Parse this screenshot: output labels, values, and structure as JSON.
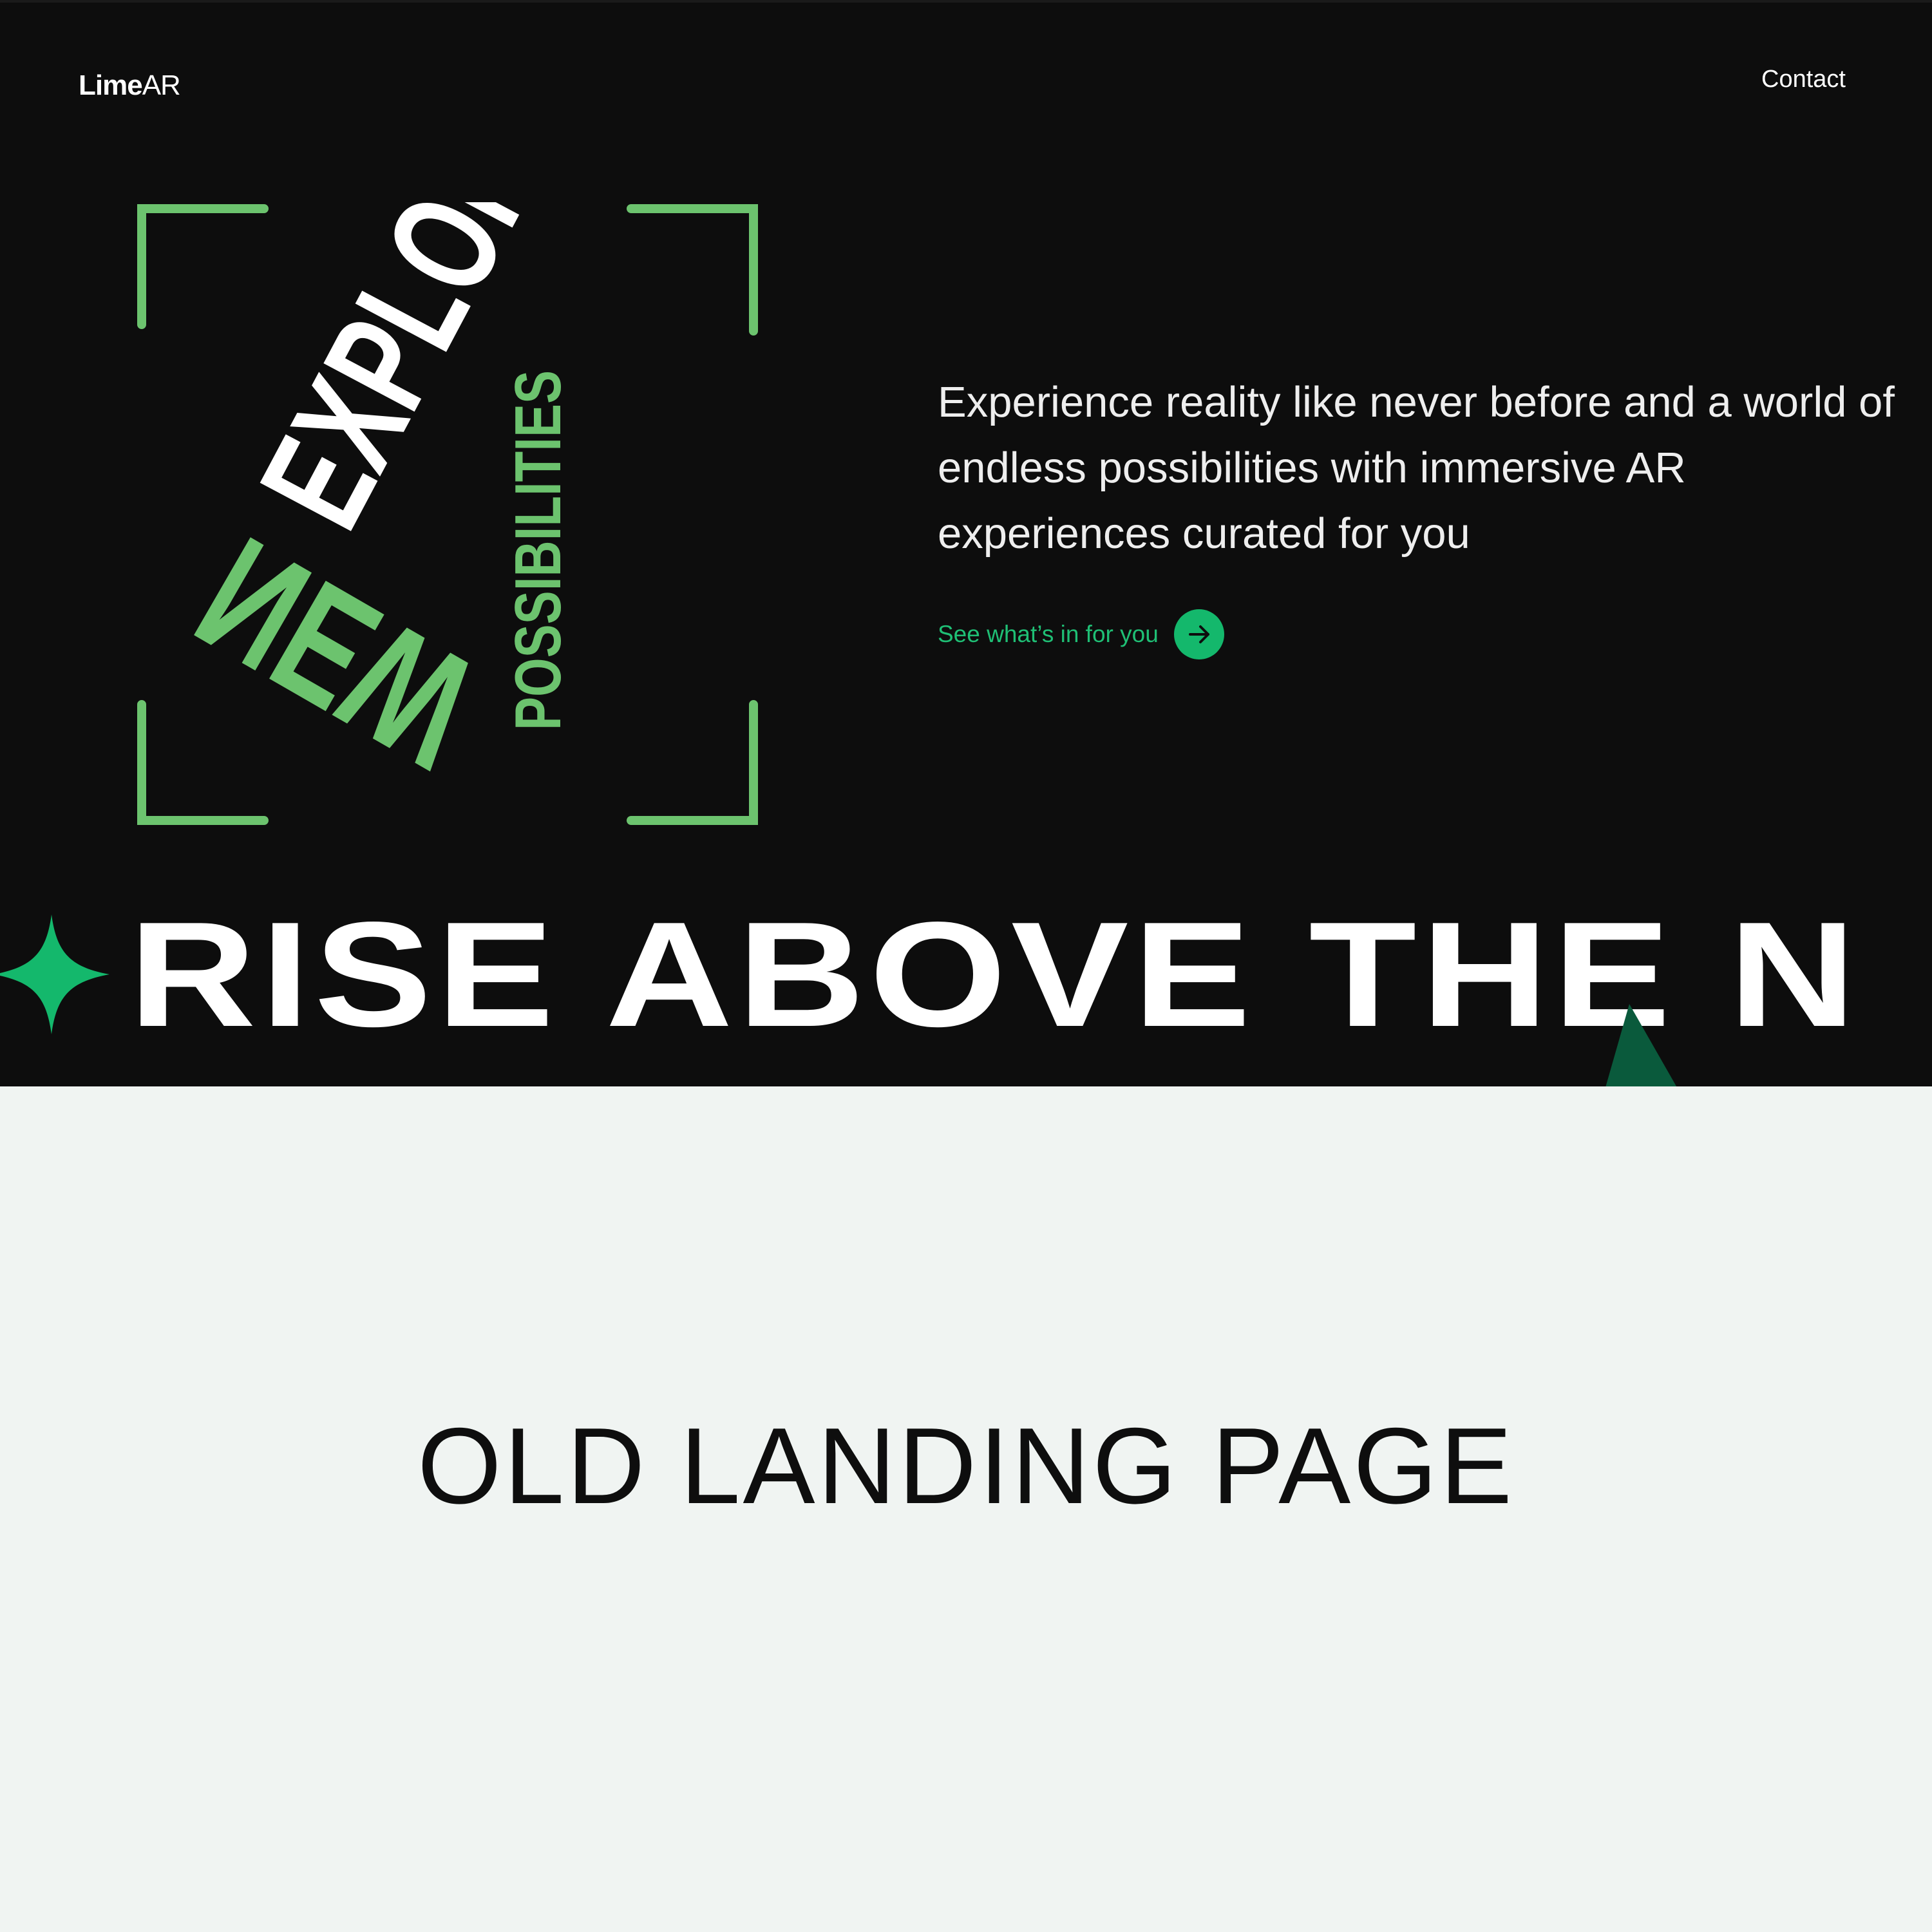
{
  "header": {
    "logo_bold": "Lime",
    "logo_light": "AR",
    "contact_label": "Contact"
  },
  "cube": {
    "top_text": "EXPLORE",
    "left_text": "NEW",
    "right_text": "POSSIBILITIES"
  },
  "hero": {
    "tagline": "Experience reality like never before and a world of endless possibilities with immersive AR experiences curated for you",
    "cta_label": "See what’s in for you"
  },
  "marquee": {
    "text": "RISE ABOVE THE N"
  },
  "caption": "OLD LANDING PAGE",
  "icons": {
    "cta": "arrow-right-icon",
    "marquee": "four-point-star-icon"
  },
  "colors": {
    "background_dark": "#0d0d0d",
    "accent_green": "#14b86c",
    "frame_green": "#6cc36e",
    "caption_bg": "#f0f4f2"
  }
}
